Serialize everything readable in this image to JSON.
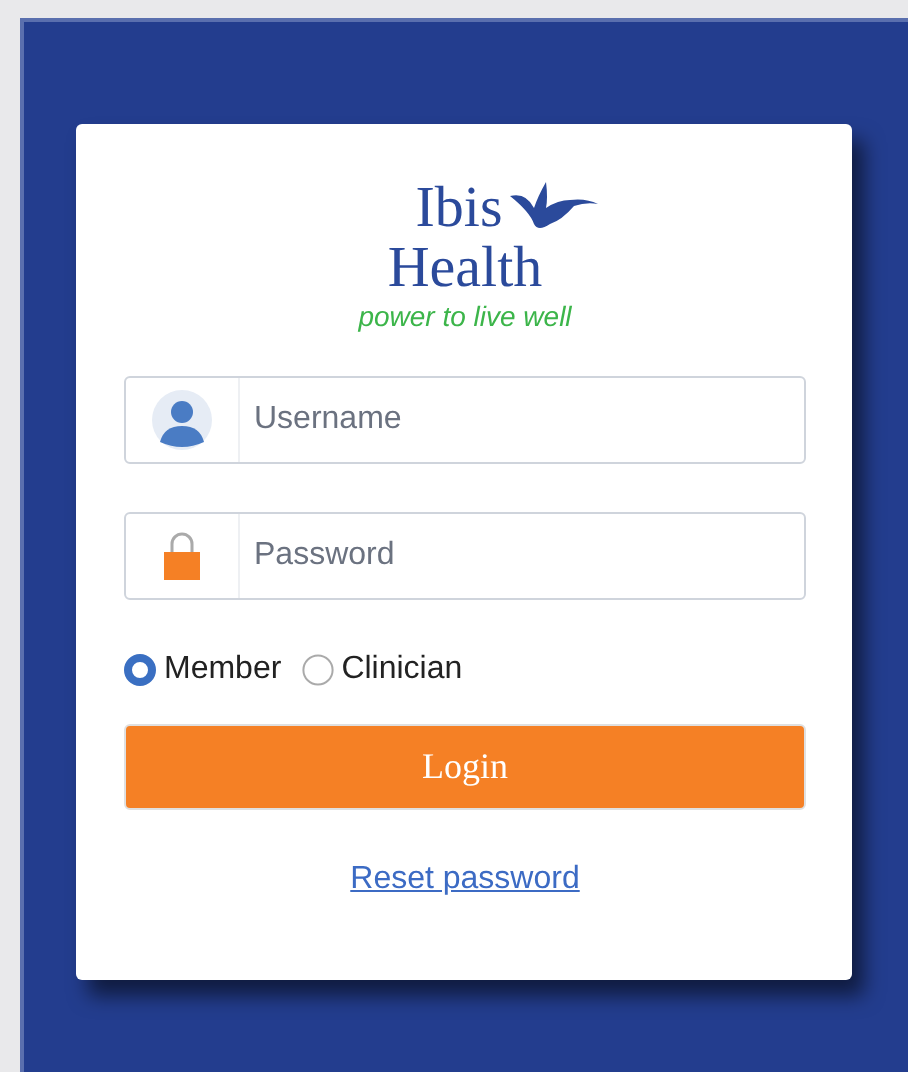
{
  "logo": {
    "line_1": "Ibis",
    "line_2": "Health",
    "tagline": "power to live well"
  },
  "fields": [
    {
      "kind": "user",
      "placeholder": "Username"
    },
    {
      "kind": "lock",
      "placeholder": "Password"
    }
  ],
  "roles": [
    {
      "label": "Member",
      "selected": true
    },
    {
      "label": "Clinician",
      "selected": false
    }
  ],
  "login_button": "Login",
  "reset_link": "Reset password"
}
